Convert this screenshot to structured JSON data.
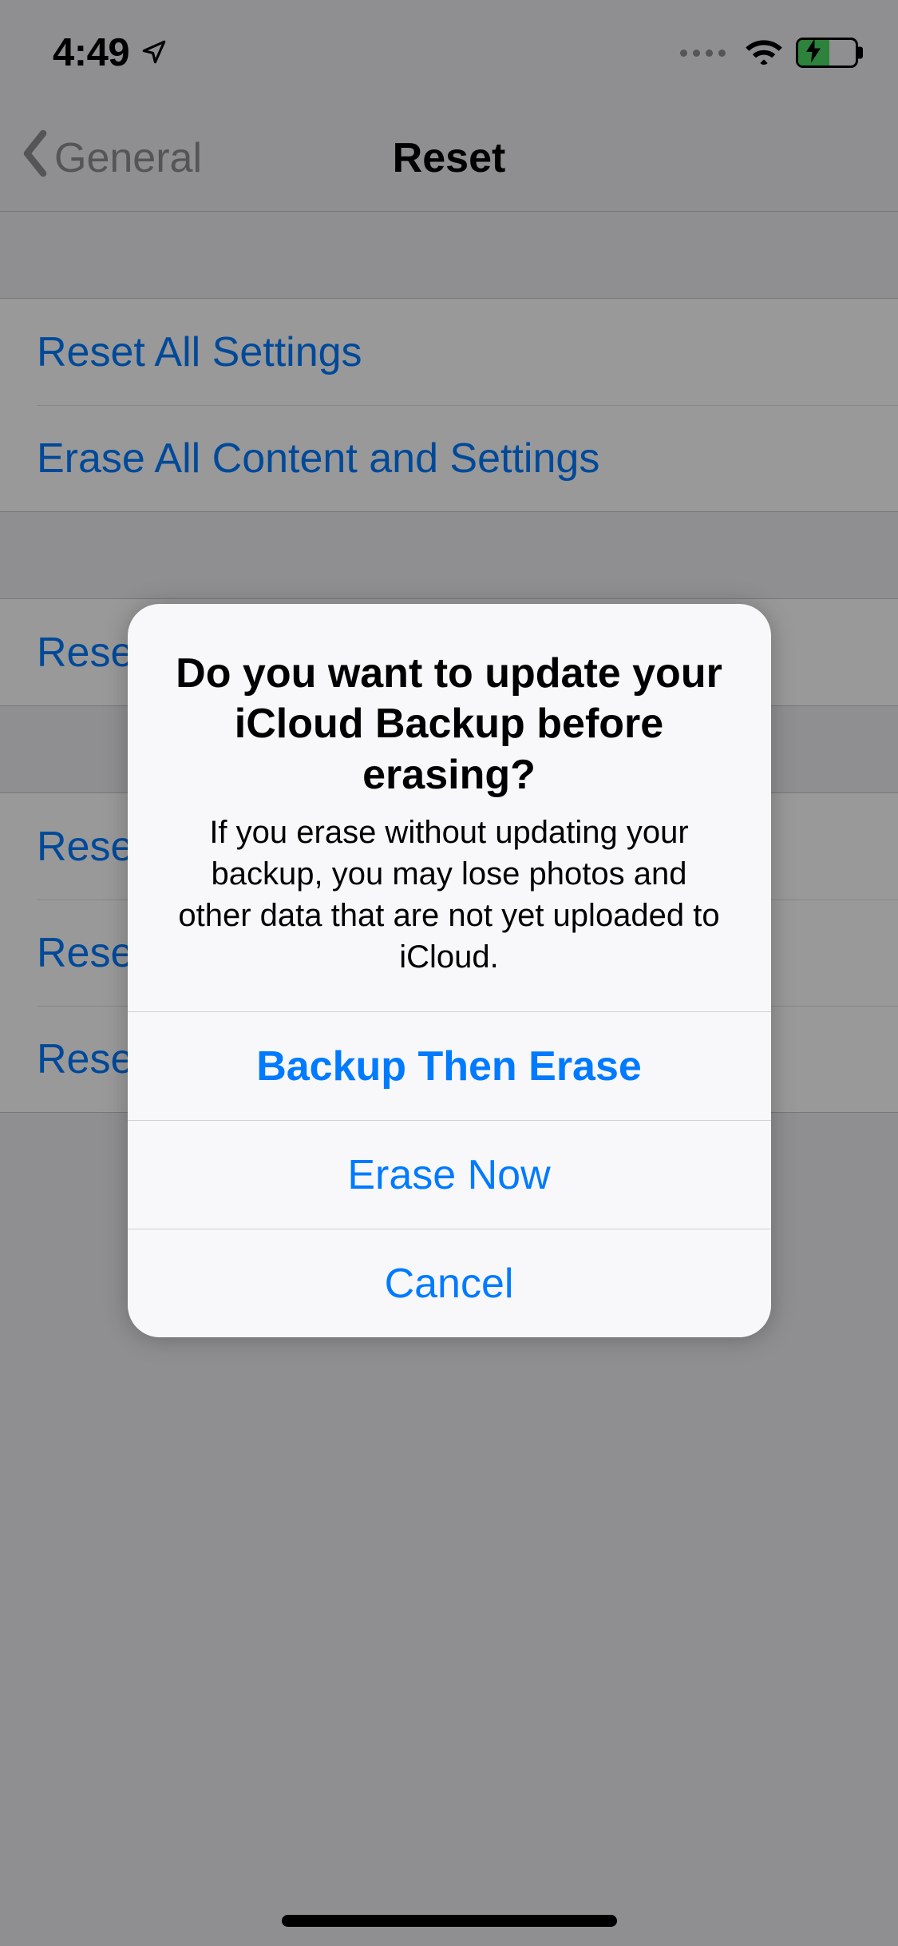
{
  "status": {
    "time": "4:49"
  },
  "nav": {
    "back": "General",
    "title": "Reset"
  },
  "groups": {
    "g1": [
      {
        "label": "Reset All Settings"
      },
      {
        "label": "Erase All Content and Settings"
      }
    ],
    "g2": [
      {
        "label": "Reset Network Settings"
      }
    ],
    "g3": [
      {
        "label": "Reset Keyboard Dictionary"
      },
      {
        "label": "Reset Home Screen Layout"
      },
      {
        "label": "Reset Location & Privacy"
      }
    ]
  },
  "alert": {
    "title": "Do you want to update your iCloud Backup before erasing?",
    "message": "If you erase without updating your backup, you may lose photos and other data that are not yet uploaded to iCloud.",
    "buttons": {
      "primary": "Backup Then Erase",
      "secondary": "Erase Now",
      "cancel": "Cancel"
    }
  }
}
